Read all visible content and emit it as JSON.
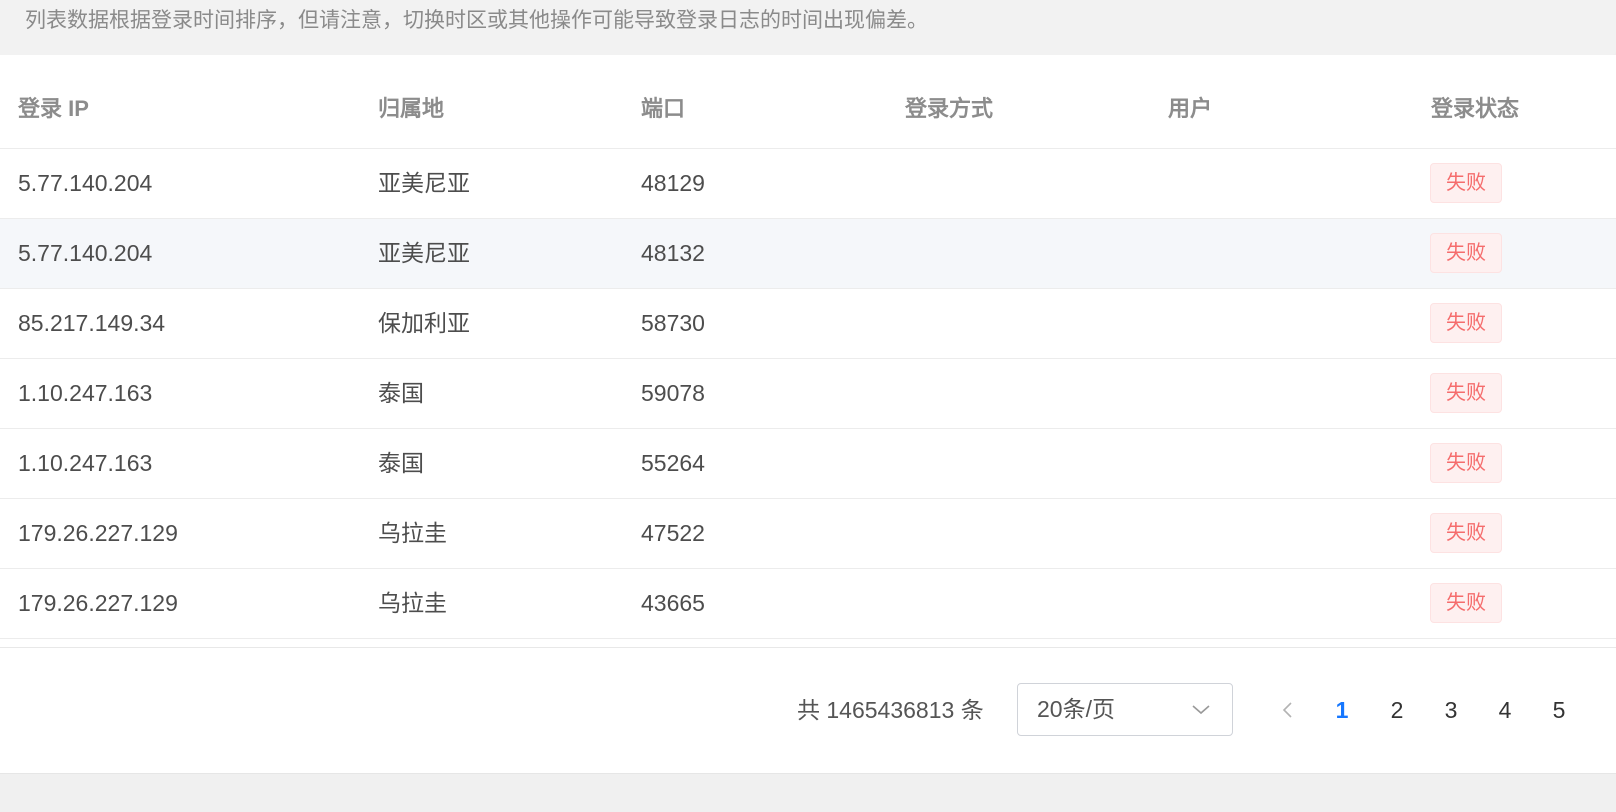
{
  "notice": {
    "text": "列表数据根据登录时间排序，但请注意，切换时区或其他操作可能导致登录日志的时间出现偏差。"
  },
  "table": {
    "columns": [
      "登录 IP",
      "归属地",
      "端口",
      "登录方式",
      "用户",
      "登录状态"
    ],
    "rows": [
      {
        "ip": "5.77.140.204",
        "location": "亚美尼亚",
        "port": "48129",
        "method": "",
        "user": "",
        "status": "失败"
      },
      {
        "ip": "5.77.140.204",
        "location": "亚美尼亚",
        "port": "48132",
        "method": "",
        "user": "",
        "status": "失败"
      },
      {
        "ip": "85.217.149.34",
        "location": "保加利亚",
        "port": "58730",
        "method": "",
        "user": "",
        "status": "失败"
      },
      {
        "ip": "1.10.247.163",
        "location": "泰国",
        "port": "59078",
        "method": "",
        "user": "",
        "status": "失败"
      },
      {
        "ip": "1.10.247.163",
        "location": "泰国",
        "port": "55264",
        "method": "",
        "user": "",
        "status": "失败"
      },
      {
        "ip": "179.26.227.129",
        "location": "乌拉圭",
        "port": "47522",
        "method": "",
        "user": "",
        "status": "失败"
      },
      {
        "ip": "179.26.227.129",
        "location": "乌拉圭",
        "port": "43665",
        "method": "",
        "user": "",
        "status": "失败"
      }
    ],
    "hovered_row": 1
  },
  "pagination": {
    "total_text": "共 1465436813 条",
    "page_size": "20条/页",
    "pages": [
      "1",
      "2",
      "3",
      "4",
      "5"
    ],
    "current_page": "1",
    "prev_icon": "chevron-left-icon",
    "select_icon": "chevron-down-icon"
  },
  "colors": {
    "status_fail_text": "#f56c6c",
    "status_fail_bg": "#fef0f0",
    "active_page": "#1677ff",
    "hover_row_bg": "#f5f7fa"
  }
}
